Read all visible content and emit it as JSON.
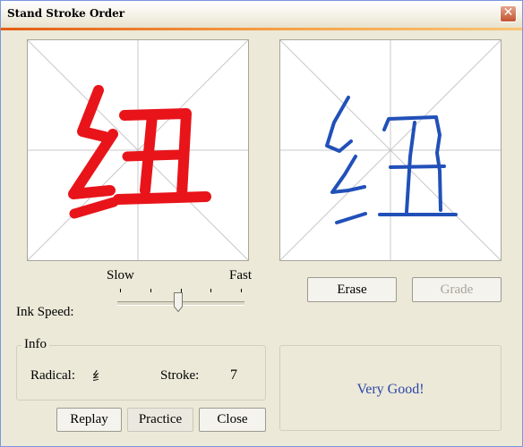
{
  "window": {
    "title": "Stand Stroke Order",
    "close_glyph": "✕"
  },
  "character": {
    "glyph": "纽",
    "model_color": "#e8141a",
    "practice_color": "#2150b8"
  },
  "controls": {
    "erase_label": "Erase",
    "grade_label": "Grade",
    "grade_enabled": false,
    "slow_label": "Slow",
    "fast_label": "Fast",
    "ink_speed_label": "Ink Speed:",
    "ink_speed_value": 0.48
  },
  "info": {
    "legend": "Info",
    "radical_label": "Radical:",
    "radical_value": "纟",
    "stroke_label": "Stroke:",
    "stroke_value": "7"
  },
  "buttons": {
    "replay_label": "Replay",
    "practice_label": "Practice",
    "close_label": "Close"
  },
  "feedback": {
    "message": "Very Good!"
  }
}
